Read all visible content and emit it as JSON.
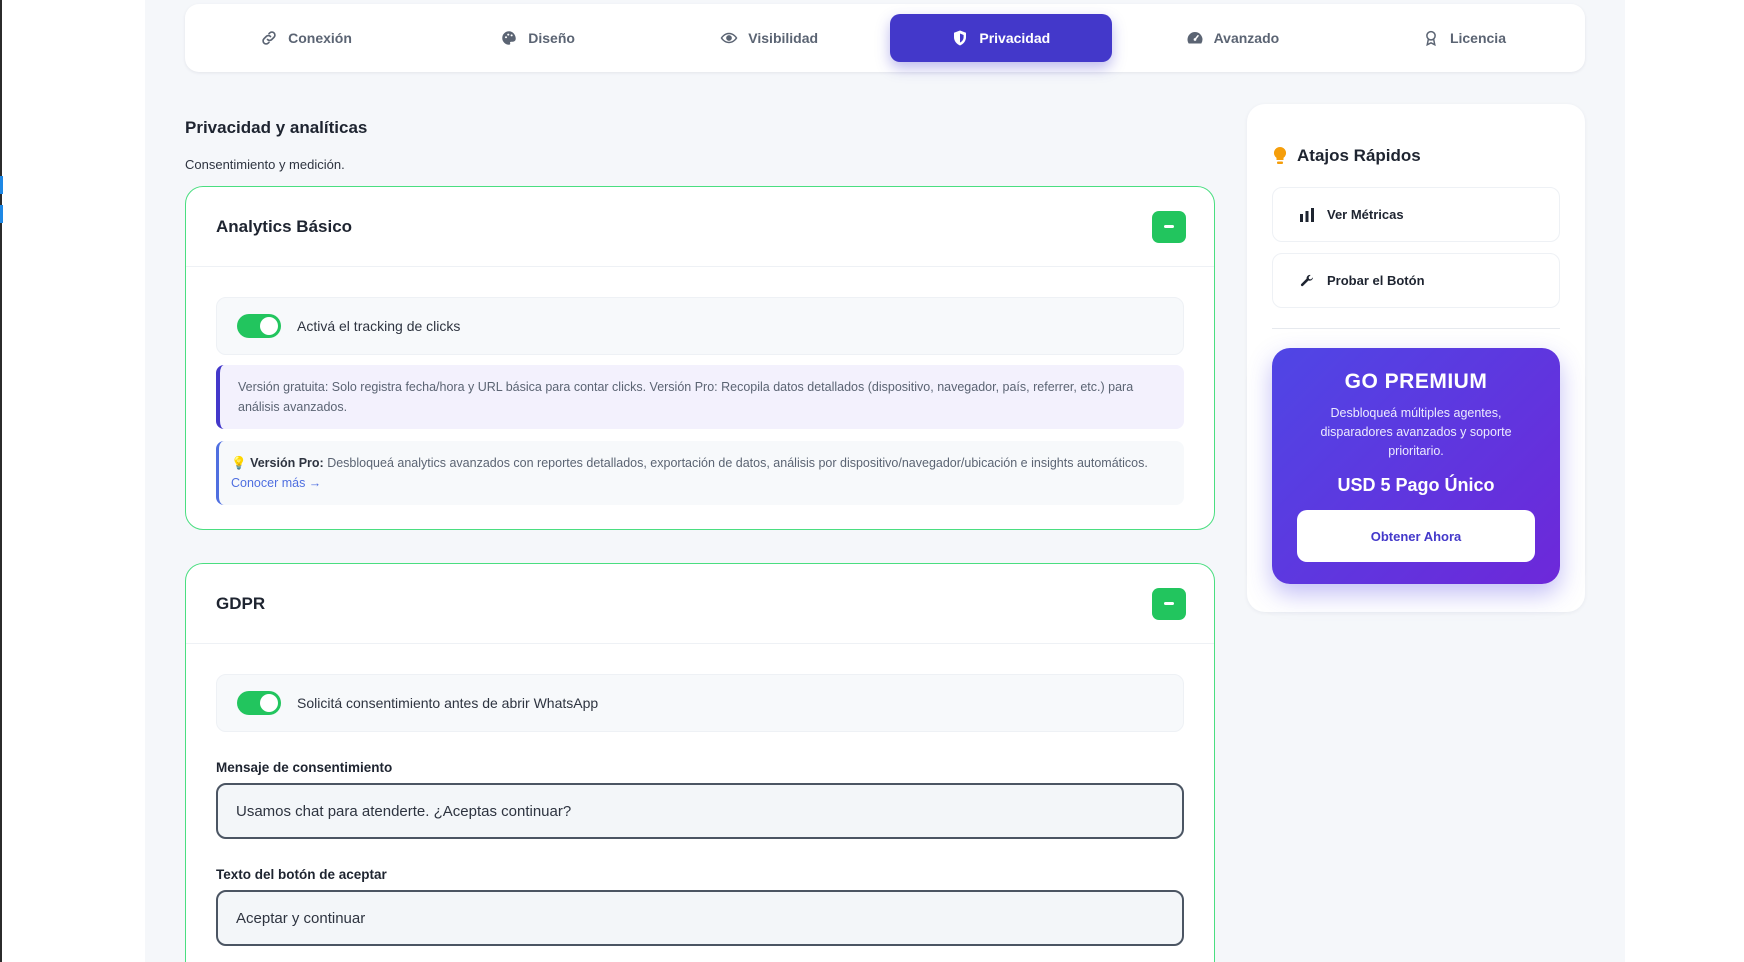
{
  "tabs": [
    {
      "label": "Conexión",
      "icon": "link-icon"
    },
    {
      "label": "Diseño",
      "icon": "palette-icon"
    },
    {
      "label": "Visibilidad",
      "icon": "eye-icon"
    },
    {
      "label": "Privacidad",
      "icon": "shield-icon",
      "active": true
    },
    {
      "label": "Avanzado",
      "icon": "gauge-icon"
    },
    {
      "label": "Licencia",
      "icon": "award-icon"
    }
  ],
  "colors": {
    "accent": "#4338ca",
    "success": "#22c55e",
    "card_border": "#4ade80",
    "background": "#f5f7fa"
  },
  "section": {
    "title": "Privacidad y analíticas",
    "subtitle": "Consentimiento y medición."
  },
  "analytics": {
    "title": "Analytics Básico",
    "toggle_label": "Activá el tracking de clicks",
    "toggle_on": true,
    "info": "Versión gratuita: Solo registra fecha/hora y URL básica para contar clicks. Versión Pro: Recopila datos detallados (dispositivo, navegador, país, referrer, etc.) para análisis avanzados.",
    "pro_icon": "💡",
    "pro_label": "Versión Pro:",
    "pro_text": "Desbloqueá analytics avanzados con reportes detallados, exportación de datos, análisis por dispositivo/navegador/ubicación e insights automáticos.",
    "pro_link": "Conocer más →"
  },
  "gdpr": {
    "title": "GDPR",
    "toggle_label": "Solicitá consentimiento antes de abrir WhatsApp",
    "toggle_on": true,
    "message_label": "Mensaje de consentimiento",
    "message_value": "Usamos chat para atenderte. ¿Aceptas continuar?",
    "accept_label": "Texto del botón de aceptar",
    "accept_value": "Aceptar y continuar"
  },
  "sidebar": {
    "title": "Atajos Rápidos",
    "title_icon": "lightbulb-icon",
    "buttons": [
      {
        "label": "Ver Métricas",
        "icon": "bar-chart-icon"
      },
      {
        "label": "Probar el Botón",
        "icon": "wrench-icon"
      }
    ],
    "premium": {
      "title": "GO PREMIUM",
      "description": "Desbloqueá múltiples agentes, disparadores avanzados y soporte prioritario.",
      "price": "USD 5 Pago Único",
      "button": "Obtener Ahora"
    }
  }
}
